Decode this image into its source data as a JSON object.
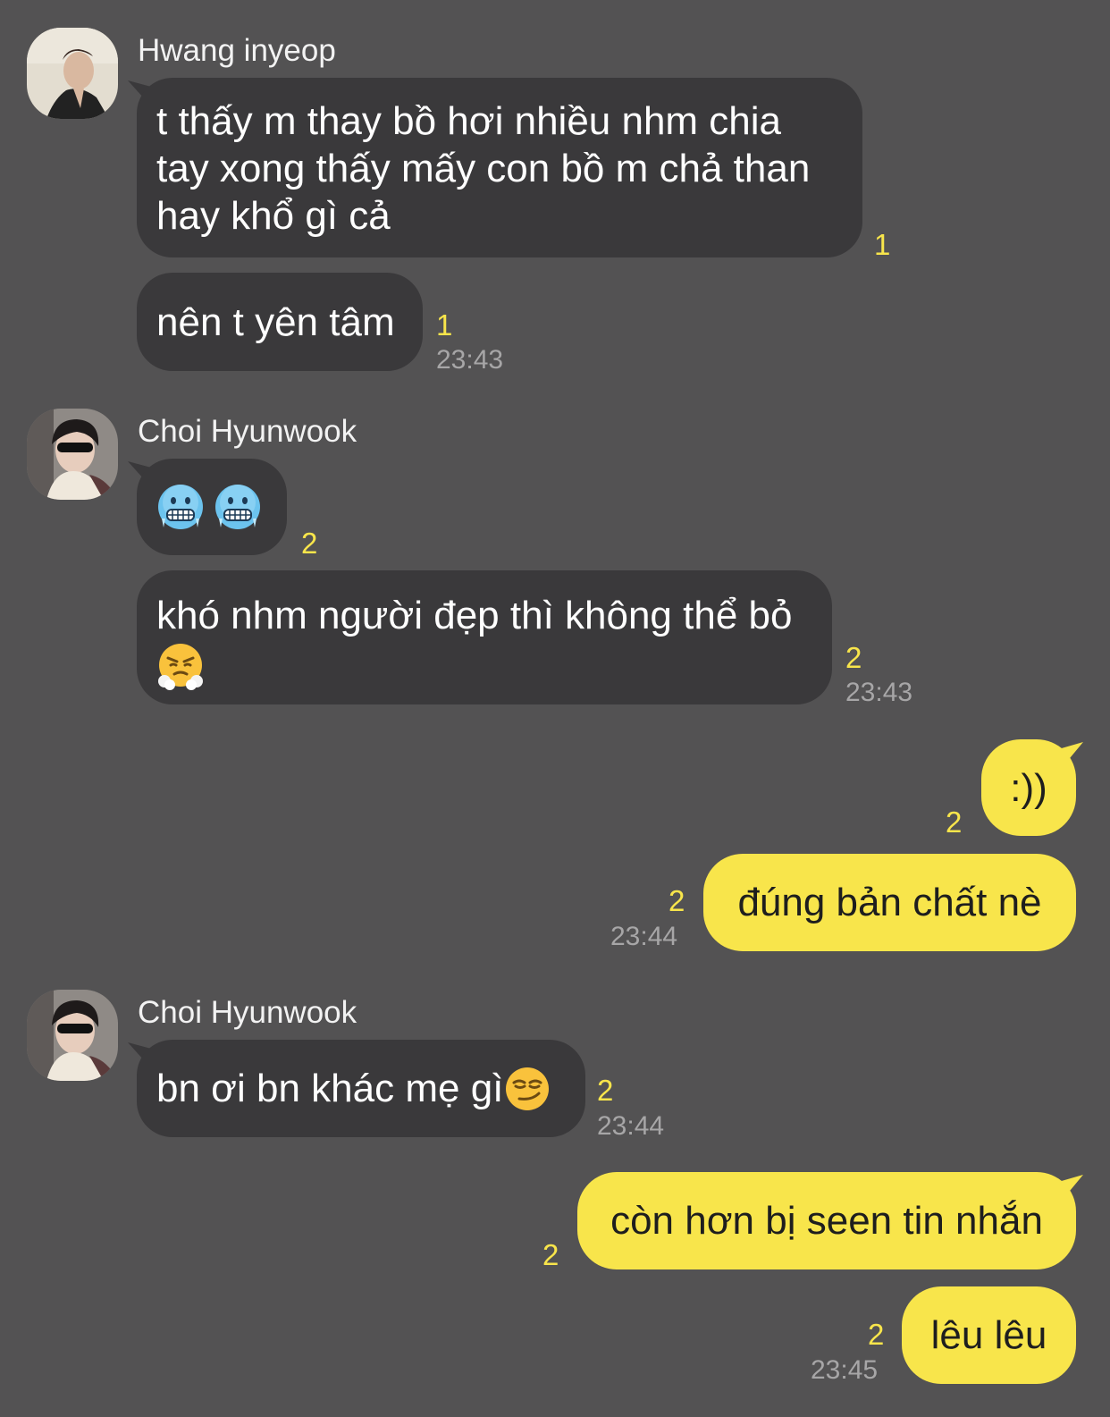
{
  "messages": {
    "m1": {
      "sender": "Hwang inyeop",
      "text": "t thấy m thay bồ hơi nhiều nhm chia tay xong thấy mấy con bồ m chả than hay khổ gì cả",
      "unread": "1"
    },
    "m2": {
      "text": "nên t yên tâm",
      "unread": "1",
      "time": "23:43"
    },
    "m3": {
      "sender": "Choi Hyunwook",
      "emoji": [
        "cold-face",
        "cold-face"
      ],
      "unread": "2"
    },
    "m4": {
      "text": "khó nhm người đẹp thì không thể bỏ",
      "emoji": "face-with-steam-from-nose",
      "unread": "2",
      "time": "23:43"
    },
    "m5": {
      "text": ":))",
      "unread": "2"
    },
    "m6": {
      "text": "đúng bản chất nè",
      "unread": "2",
      "time": "23:44"
    },
    "m7": {
      "sender": "Choi Hyunwook",
      "text": "bn ơi bn khác mẹ gì",
      "emoji": "smirking-face",
      "unread": "2",
      "time": "23:44"
    },
    "m8": {
      "text": "còn hơn bị seen tin nhắn",
      "unread": "2"
    },
    "m9": {
      "text": "lêu lêu",
      "unread": "2",
      "time": "23:45"
    }
  },
  "colors": {
    "background": "#535253",
    "incoming_bubble": "#3a393b",
    "outgoing_bubble": "#f8e54b",
    "unread_count": "#f8e54b",
    "timestamp": "#a7a6a7"
  }
}
